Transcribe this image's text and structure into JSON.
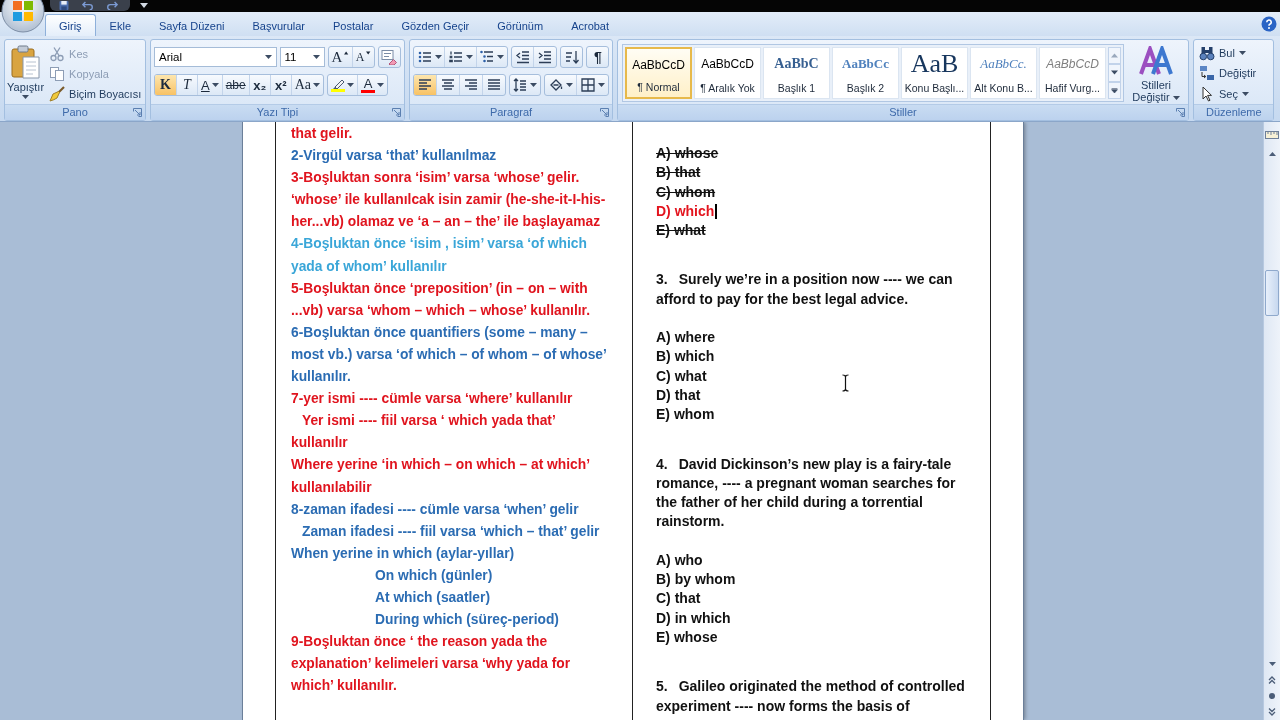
{
  "tabs": [
    {
      "label": "Giriş",
      "selected": true
    },
    {
      "label": "Ekle",
      "selected": false
    },
    {
      "label": "Sayfa Düzeni",
      "selected": false
    },
    {
      "label": "Başvurular",
      "selected": false
    },
    {
      "label": "Postalar",
      "selected": false
    },
    {
      "label": "Gözden Geçir",
      "selected": false
    },
    {
      "label": "Görünüm",
      "selected": false
    },
    {
      "label": "Acrobat",
      "selected": false
    }
  ],
  "ribbon": {
    "groups": [
      {
        "kind": "clipboard",
        "title": "Pano",
        "launcher": true,
        "paste": {
          "label": "Yapıştır"
        },
        "items": [
          {
            "label": "Kes",
            "kind": "cut",
            "disabled": true
          },
          {
            "label": "Kopyala",
            "kind": "copy",
            "disabled": true
          },
          {
            "label": "Biçim Boyacısı",
            "kind": "format-painter",
            "disabled": false
          }
        ]
      },
      {
        "kind": "font",
        "title": "Yazı Tipi",
        "launcher": true,
        "font_field": {
          "value": "Arial"
        },
        "size_field": {
          "value": "11"
        },
        "size_buttons": [
          {
            "label": "A",
            "kind": "grow"
          },
          {
            "label": "A",
            "kind": "shrink"
          }
        ],
        "format_clusters": [
          [
            {
              "label": "K",
              "kind": "bold",
              "active": true,
              "dropdown": false
            },
            {
              "label": "T",
              "kind": "italic",
              "active": false,
              "dropdown": false
            },
            {
              "label": "A",
              "kind": "underline",
              "active": false,
              "dropdown": true
            },
            {
              "label": "abe",
              "kind": "strike",
              "active": false,
              "dropdown": false
            },
            {
              "label": "x₂",
              "kind": "subscript",
              "active": false,
              "dropdown": false
            },
            {
              "label": "x²",
              "kind": "superscript",
              "active": false,
              "dropdown": false
            },
            {
              "label": "Aa",
              "kind": "case",
              "active": false,
              "dropdown": true
            }
          ],
          [
            {
              "kind": "highlight",
              "color": "#ffff00",
              "active": false,
              "dropdown": true
            },
            {
              "label": "A",
              "kind": "font-color",
              "color": "#ff0000",
              "active": false,
              "dropdown": true
            }
          ]
        ]
      },
      {
        "kind": "paragraph",
        "title": "Paragraf",
        "launcher": true,
        "rows": [
          [
            [
              {
                "kind": "bullets",
                "active": false,
                "dropdown": true
              },
              {
                "kind": "numbering",
                "active": false,
                "dropdown": true
              },
              {
                "kind": "multilevel",
                "active": false,
                "dropdown": true
              }
            ],
            [
              {
                "kind": "outdent",
                "active": false,
                "dropdown": false
              },
              {
                "kind": "indent",
                "active": false,
                "dropdown": false
              }
            ],
            [
              {
                "kind": "sort",
                "active": false,
                "dropdown": false
              }
            ],
            [
              {
                "kind": "pilcrow",
                "label": "¶",
                "active": false,
                "dropdown": false
              }
            ]
          ],
          [
            [
              {
                "kind": "align-left",
                "active": true,
                "dropdown": false
              },
              {
                "kind": "align-center",
                "active": false,
                "dropdown": false
              },
              {
                "kind": "align-right",
                "active": false,
                "dropdown": false
              },
              {
                "kind": "justify",
                "active": false,
                "dropdown": false
              }
            ],
            [
              {
                "kind": "line-spacing",
                "active": false,
                "dropdown": true
              }
            ],
            [
              {
                "kind": "shading",
                "active": false,
                "dropdown": true
              },
              {
                "kind": "borders",
                "active": false,
                "dropdown": true
              }
            ]
          ]
        ]
      },
      {
        "kind": "styles",
        "title": "Stiller",
        "launcher": true,
        "gallery": [
          {
            "preview": "AaBbCcD",
            "label": "¶ Normal",
            "kind": "normal",
            "selected": true
          },
          {
            "preview": "AaBbCcD",
            "label": "¶ Aralık Yok",
            "kind": "no-spacing",
            "selected": false
          },
          {
            "preview": "AaBbC",
            "label": "Başlık 1",
            "kind": "heading1",
            "selected": false
          },
          {
            "preview": "AaBbCc",
            "label": "Başlık 2",
            "kind": "heading2",
            "selected": false
          },
          {
            "preview": "AaB",
            "label": "Konu Başlı...",
            "kind": "title",
            "selected": false
          },
          {
            "preview": "AaBbCc.",
            "label": "Alt Konu B...",
            "kind": "subtitle",
            "selected": false
          },
          {
            "preview": "AaBbCcD",
            "label": "Hafif Vurg...",
            "kind": "emphasis",
            "selected": false
          }
        ],
        "change_styles": {
          "label": "Stilleri Değiştir"
        }
      },
      {
        "kind": "editing",
        "title": "Düzenleme",
        "launcher": false,
        "items": [
          {
            "label": "Bul",
            "kind": "find",
            "dropdown": true
          },
          {
            "label": "Değiştir",
            "kind": "replace",
            "dropdown": false
          },
          {
            "label": "Seç",
            "kind": "select",
            "dropdown": true
          }
        ]
      }
    ]
  },
  "document": {
    "left_column": [
      {
        "text": "that gelir.",
        "color": "#e0141e",
        "indented": false
      },
      {
        "text": "2-Virgül varsa ‘that’ kullanılmaz",
        "color": "#2b6cb3",
        "indented": false
      },
      {
        "text": "3-Boşluktan sonra ‘isim’ varsa ‘whose’ gelir.",
        "color": "#e0141e",
        "indented": false
      },
      {
        "text": "‘whose’ ile kullanılcak isin zamir (he-she-it-I-his-\nher...vb) olamaz ve ‘a – an – the’ ile başlayamaz",
        "color": "#e0141e",
        "indented": false
      },
      {
        "text": "4-Boşluktan önce ‘isim , isim’ varsa ‘of which\nyada of whom’ kullanılır",
        "color": "#3aa6d8",
        "indented": false
      },
      {
        "text": "5-Boşluktan önce ‘preposition’ (in – on – with\n...vb) varsa ‘whom – which – whose’ kullanılır.",
        "color": "#e0141e",
        "indented": false
      },
      {
        "text": "6-Boşluktan önce quantifiers (some – many –\nmost vb.) varsa ‘of which – of whom – of whose’\nkullanılır.",
        "color": "#2b6cb3",
        "indented": false
      },
      {
        "text": "7-yer ismi ---- cümle varsa ‘where’ kullanılır",
        "color": "#e0141e",
        "indented": false
      },
      {
        "text": "Yer ismi ---- fiil varsa ‘ which yada that’\nkullanılır",
        "color": "#e0141e",
        "indented": true
      },
      {
        "text": "Where yerine ‘in which – on which – at which’\nkullanılabilir",
        "color": "#e0141e",
        "indented": false
      },
      {
        "text": "8-zaman ifadesi ---- cümle varsa ‘when’ gelir",
        "color": "#2b6cb3",
        "indented": false
      },
      {
        "text": "Zaman ifadesi ---- fiil varsa ‘which – that’ gelir",
        "color": "#2b6cb3",
        "indented": true
      },
      {
        "text": "When yerine in which (aylar-yıllar)",
        "color": "#2b6cb3",
        "indented": false,
        "children": [
          {
            "text": "On which (günler)",
            "color": "#2b6cb3",
            "indented": false
          },
          {
            "text": "At which (saatler)",
            "color": "#2b6cb3",
            "indented": false
          },
          {
            "text": "During which (süreç-period)",
            "color": "#2b6cb3",
            "indented": false
          }
        ]
      },
      {
        "text": "9-Boşluktan önce ‘ the reason yada the\nexplanation’ kelimeleri varsa ‘why yada for\nwhich’ kullanılır.",
        "color": "#e0141e",
        "indented": false
      }
    ],
    "questions": [
      {
        "options": [
          {
            "text": "A) whose",
            "struck": true,
            "marked": false,
            "caret": false
          },
          {
            "text": "B) that",
            "struck": true,
            "marked": false,
            "caret": false
          },
          {
            "text": "C) whom",
            "struck": true,
            "marked": false,
            "caret": false
          },
          {
            "text": "D) which",
            "struck": false,
            "marked": true,
            "caret": true
          },
          {
            "text": "E) what",
            "struck": true,
            "marked": false,
            "caret": false
          }
        ]
      },
      {
        "number": "3.",
        "text": "Surely we’re in a position now ---- we can\nafford to pay for the best legal advice.",
        "options": [
          {
            "text": "A) where"
          },
          {
            "text": "B) which"
          },
          {
            "text": "C) what"
          },
          {
            "text": "D) that"
          },
          {
            "text": "E) whom"
          }
        ]
      },
      {
        "number": "4.",
        "text": "David Dickinson’s new play is a fairy-tale\nromance, ---- a pregnant woman searches for\nthe father of her child during a torrential\nrainstorm.",
        "options": [
          {
            "text": "A) who"
          },
          {
            "text": "B) by whom"
          },
          {
            "text": "C) that"
          },
          {
            "text": "D) in which"
          },
          {
            "text": "E) whose"
          }
        ]
      },
      {
        "number": "5.",
        "text": "Galileo originated the method of controlled\nexperiment ---- now forms the basis of"
      }
    ]
  }
}
